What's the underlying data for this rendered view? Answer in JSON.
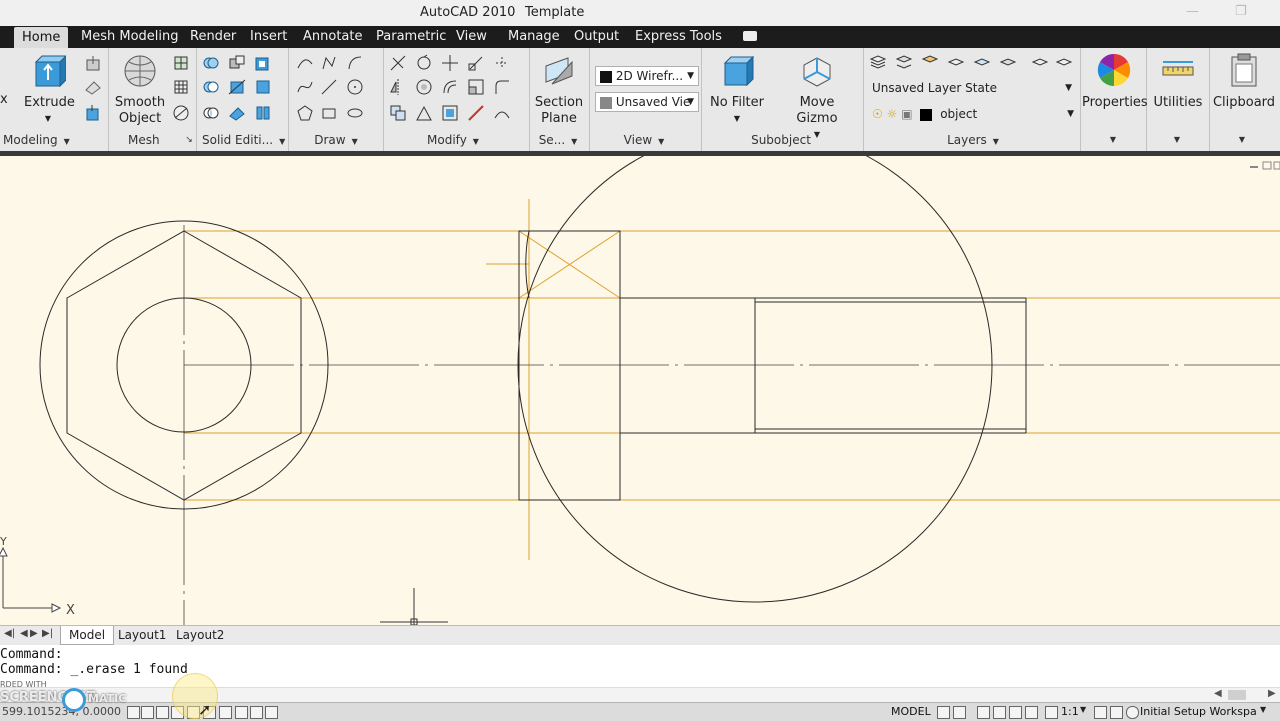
{
  "window": {
    "app_title": "AutoCAD 2010",
    "doc_title": "Template"
  },
  "tabs": [
    "Home",
    "Mesh Modeling",
    "Render",
    "Insert",
    "Annotate",
    "Parametric",
    "View",
    "Manage",
    "Output",
    "Express Tools"
  ],
  "ribbon": {
    "extrude_partial": "x",
    "extrude": "Extrude",
    "smooth_object": [
      "Smooth",
      "Object"
    ],
    "section_plane": [
      "Section",
      "Plane"
    ],
    "visual_style": "2D Wirefr...",
    "saved_view": "Unsaved Vie",
    "no_filter": "No Filter",
    "move_gizmo": "Move Gizmo",
    "layer_state": "Unsaved Layer State",
    "layer_name": "object",
    "properties": "Properties",
    "utilities": "Utilities",
    "clipboard": "Clipboard",
    "panels": {
      "modeling": "Modeling",
      "mesh": "Mesh",
      "solid_editing": "Solid Editi...",
      "draw": "Draw",
      "modify": "Modify",
      "section": "Se...",
      "view": "View",
      "subobject": "Subobject",
      "layers": "Layers"
    }
  },
  "ucs": {
    "x": "X",
    "y": "Y"
  },
  "layout_tabs": [
    "Model",
    "Layout1",
    "Layout2"
  ],
  "command_lines": [
    "Command:",
    "Command:  _.erase 1 found"
  ],
  "watermark": {
    "line1": "RDED WITH",
    "line2": "SCREENCAST",
    "line3": "MATIC"
  },
  "status": {
    "coordinates": "599.1015234, 0.0000",
    "model": "MODEL",
    "scale": "1:1",
    "workspace": "Initial Setup Workspa"
  },
  "colors": {
    "tab_bar": "#1c1c1c",
    "canvas": "#fdf8e8",
    "construction_line": "#e0a030",
    "object_line": "#2a2a2a"
  }
}
